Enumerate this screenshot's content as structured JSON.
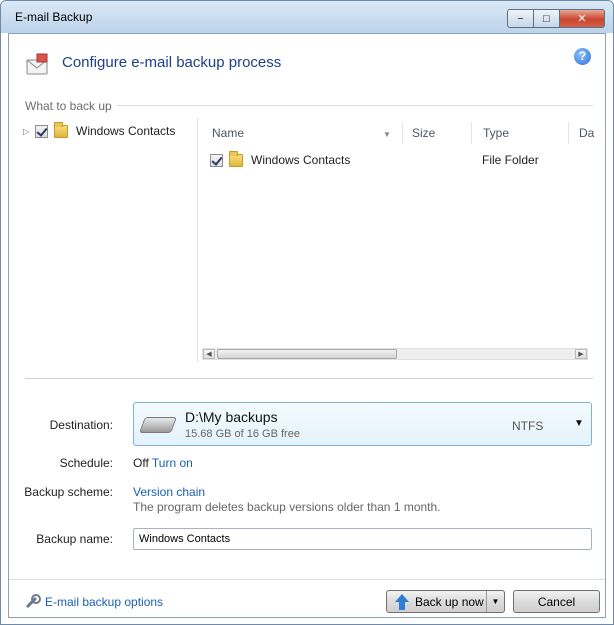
{
  "window": {
    "title": "E-mail Backup",
    "minimize_glyph": "−",
    "maximize_glyph": "□",
    "close_glyph": "✕"
  },
  "header": {
    "title": "Configure e-mail backup process",
    "help_glyph": "?"
  },
  "what_to_back_up": {
    "label": "What to back up",
    "tree": [
      {
        "label": "Windows Contacts",
        "checked": true
      }
    ],
    "columns": [
      "Name",
      "Size",
      "Type",
      "Da"
    ],
    "rows": [
      {
        "name": "Windows Contacts",
        "size": "",
        "type": "File Folder",
        "checked": true
      }
    ]
  },
  "destination": {
    "label": "Destination:",
    "path": "D:\\My backups",
    "free_space": "15.68 GB of 16 GB free",
    "filesystem": "NTFS"
  },
  "schedule": {
    "label": "Schedule:",
    "value": "Off",
    "link": "Turn on"
  },
  "backup_scheme": {
    "label": "Backup scheme:",
    "value": "Version chain",
    "description": "The program deletes backup versions older than 1 month."
  },
  "backup_name": {
    "label": "Backup name:",
    "value": "Windows Contacts"
  },
  "footer": {
    "options_link": "E-mail backup options",
    "back_up_now": "Back up now",
    "cancel": "Cancel"
  },
  "colors": {
    "accent": "#1a5fb4",
    "title_blue": "#1d3f8a",
    "dest_border": "#7fb2d8"
  }
}
